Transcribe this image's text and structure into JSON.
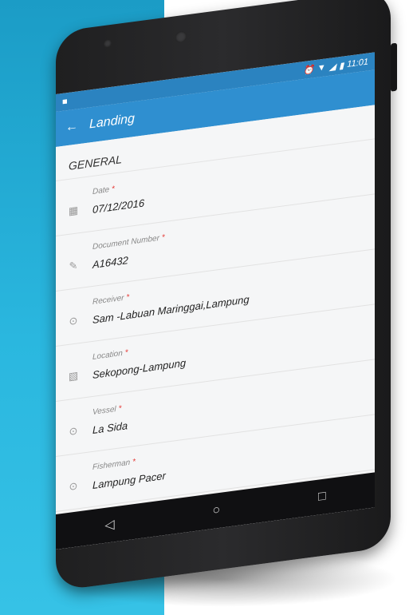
{
  "status_bar": {
    "time": "11:01",
    "icons": [
      "alarm-icon",
      "wifi-icon",
      "signal-icon",
      "battery-icon"
    ]
  },
  "appbar": {
    "title": "Landing",
    "back_icon": "arrow-left-icon"
  },
  "section": {
    "title": "GENERAL"
  },
  "fields": [
    {
      "label": "Date",
      "required_mark": "*",
      "value": "07/12/2016",
      "icon": "calendar-icon"
    },
    {
      "label": "Document Number",
      "required_mark": "*",
      "value": "A16432",
      "icon": "pencil-icon"
    },
    {
      "label": "Receiver",
      "required_mark": "*",
      "value": "Sam -Labuan Maringgai,Lampung",
      "icon": "circle-chevron-icon"
    },
    {
      "label": "Location",
      "required_mark": "*",
      "value": "Sekopong-Lampung",
      "icon": "map-icon"
    },
    {
      "label": "Vessel",
      "required_mark": "*",
      "value": "La Sida",
      "icon": "circle-chevron-icon"
    },
    {
      "label": "Fisherman",
      "required_mark": "*",
      "value": "Lampung  Pacer",
      "icon": "circle-chevron-icon"
    }
  ],
  "navbar": {
    "back": "back-triangle-icon",
    "home": "home-circle-icon",
    "recents": "recents-square-icon"
  },
  "colors": {
    "appbar": "#2f8fd0",
    "status_bar": "#2b83c0",
    "required": "#e53935",
    "backdrop": "#22aad6"
  }
}
